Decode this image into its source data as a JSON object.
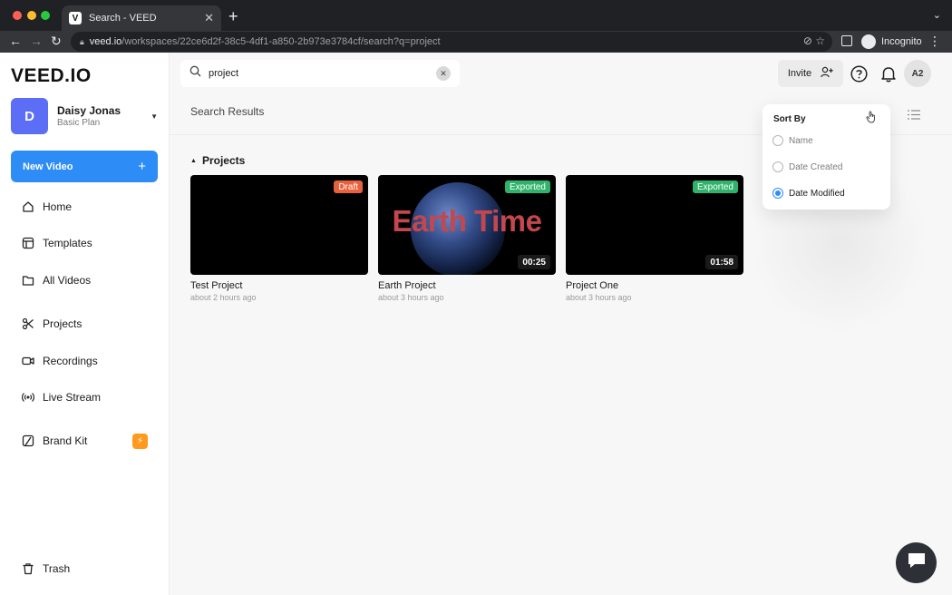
{
  "browser": {
    "tab_title": "Search - VEED",
    "tab_favicon": "V",
    "url_host": "veed.io",
    "url_path": "/workspaces/22ce6d2f-38c5-4df1-a850-2b973e3784cf/search?q=project",
    "profile_label": "Incognito"
  },
  "sidebar": {
    "logo": "VEED.IO",
    "user": {
      "initial": "D",
      "name": "Daisy Jonas",
      "plan": "Basic Plan"
    },
    "new_video_label": "New Video",
    "items": [
      {
        "label": "Home",
        "icon": "home-icon"
      },
      {
        "label": "Templates",
        "icon": "templates-icon"
      },
      {
        "label": "All Videos",
        "icon": "folder-icon"
      },
      {
        "label": "Projects",
        "icon": "scissors-icon"
      },
      {
        "label": "Recordings",
        "icon": "video-camera-icon"
      },
      {
        "label": "Live Stream",
        "icon": "broadcast-icon"
      },
      {
        "label": "Brand Kit",
        "icon": "brand-kit-icon"
      },
      {
        "label": "Trash",
        "icon": "trash-icon"
      }
    ]
  },
  "topbar": {
    "search_value": "project",
    "invite_label": "Invite",
    "account_initials": "A2"
  },
  "main": {
    "section_title": "Search Results",
    "group_title": "Projects",
    "cards": [
      {
        "title": "Test Project",
        "time": "about 2 hours ago",
        "status": "Draft",
        "status_color": "#e8603c",
        "duration": ""
      },
      {
        "title": "Earth Project",
        "time": "about 3 hours ago",
        "status": "Exported",
        "status_color": "#2fb36a",
        "duration": "00:25",
        "thumb_text": "Earth Time"
      },
      {
        "title": "Project One",
        "time": "about 3 hours ago",
        "status": "Exported",
        "status_color": "#2fb36a",
        "duration": "01:58"
      }
    ]
  },
  "sort": {
    "title": "Sort By",
    "options": [
      {
        "label": "Name",
        "selected": false
      },
      {
        "label": "Date Created",
        "selected": false
      },
      {
        "label": "Date Modified",
        "selected": true
      }
    ]
  },
  "colors": {
    "accent": "#2d8cf6",
    "avatar": "#5b6ef5",
    "badge": "#ff9a1f"
  }
}
